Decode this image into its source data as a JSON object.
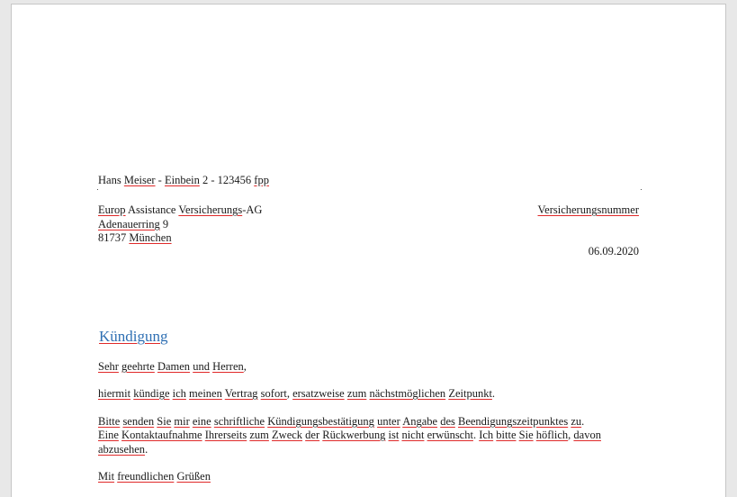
{
  "sender_line": {
    "t0": "Hans",
    "t1": "Meiser",
    "t2": "-",
    "t3": "Einbein",
    "t4": "2 - 123456",
    "t5": "fpp"
  },
  "recipient": {
    "line1": {
      "a": "Europ",
      "b": "Assistance",
      "c": "Versicherungs",
      "d": "-AG"
    },
    "line2": {
      "a": "Adenauerring",
      "b": "9"
    },
    "line3": {
      "a": "81737",
      "b": "München"
    }
  },
  "reference_label": "Versicherungsnummer",
  "date": "06.09.2020",
  "subject": "Kündigung",
  "salutation": {
    "w1": "Sehr",
    "w2": "geehrte",
    "w3": "Damen",
    "w4": "und",
    "w5": "Herren",
    "w6": ","
  },
  "paragraph1": {
    "w1": "hiermit",
    "w2": "kündige",
    "w3": "ich",
    "w4": "meinen",
    "w5": "Vertrag",
    "w6": "sofort",
    "w7": ",",
    "w8": "ersatzweise",
    "w9": "zum",
    "w10": "nächstmöglichen",
    "w11": "Zeitpunkt",
    "w12": "."
  },
  "paragraph2_line1": {
    "w1": "Bitte",
    "w2": "senden",
    "w3": "Sie",
    "w4": "mir",
    "w5": "eine",
    "w6": "schriftliche",
    "w7": "Kündigungsbestätigung",
    "w8": "unter",
    "w9": "Angabe",
    "w10": "des",
    "w11": "Beendigungszeitpunktes",
    "w12": "zu",
    "w13": "."
  },
  "paragraph2_line2": {
    "w1": "Eine",
    "w2": "Kontaktaufnahme",
    "w3": "Ihrerseits",
    "w4": "zum",
    "w5": "Zweck",
    "w6": "der",
    "w7": "Rückwerbung",
    "w8": "ist",
    "w9": "nicht",
    "w10": "erwünscht",
    "w11": ".",
    "w12": "Ich",
    "w13": "bitte",
    "w14": "Sie",
    "w15": "höflich",
    "w16": ",",
    "w17": "davon"
  },
  "paragraph2_line3": {
    "w1": "abzusehen",
    "w2": "."
  },
  "closing": {
    "w1": "Mit",
    "w2": "freundlichen",
    "w3": "Grüßen"
  }
}
